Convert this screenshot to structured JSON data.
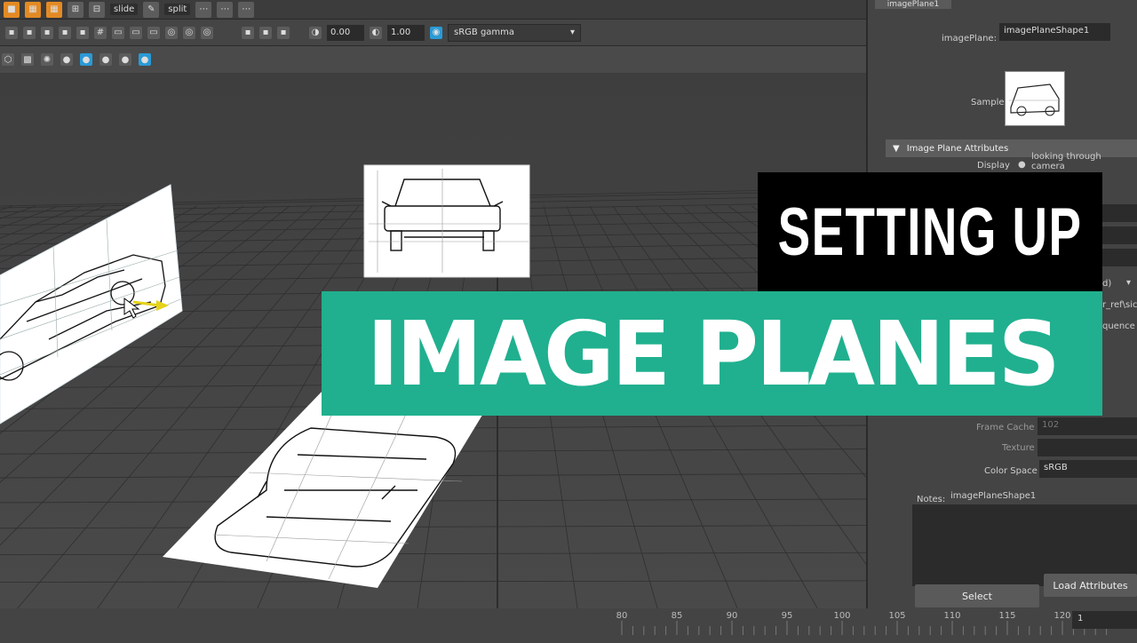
{
  "toolbar": {
    "slide_label": "slide",
    "split_label": "split",
    "exposure_value": "0.00",
    "gamma_value": "1.00",
    "color_space": "sRGB gamma"
  },
  "panel": {
    "tab_label": "imagePlane1",
    "image_plane_label": "imagePlane:",
    "image_plane_value": "imagePlaneShape1",
    "sample_label": "Sample",
    "section_title": "Image Plane Attributes",
    "display_label": "Display",
    "display_option": "looking through camera",
    "partial_d": "d)",
    "partial_path": "r_ref\\sic",
    "partial_sequence": "quence",
    "frame_cache_label": "Frame Cache",
    "frame_cache_value": "102",
    "texture_label": "Texture",
    "color_space_label": "Color Space",
    "color_space_value": "sRGB",
    "notes_label": "Notes:",
    "notes_value": "imagePlaneShape1",
    "select_button": "Select",
    "load_attributes_button": "Load Attributes"
  },
  "timeline": {
    "ticks": [
      "80",
      "85",
      "90",
      "95",
      "100",
      "105",
      "110",
      "115",
      "120"
    ],
    "current_frame": "1"
  },
  "overlay": {
    "line1": "SETTING UP",
    "line2": "IMAGE PLANES"
  },
  "colors": {
    "accent_green": "#20b08f",
    "title_black": "#000000",
    "maya_orange": "#e38a24",
    "maya_blue": "#2a9ad6"
  }
}
